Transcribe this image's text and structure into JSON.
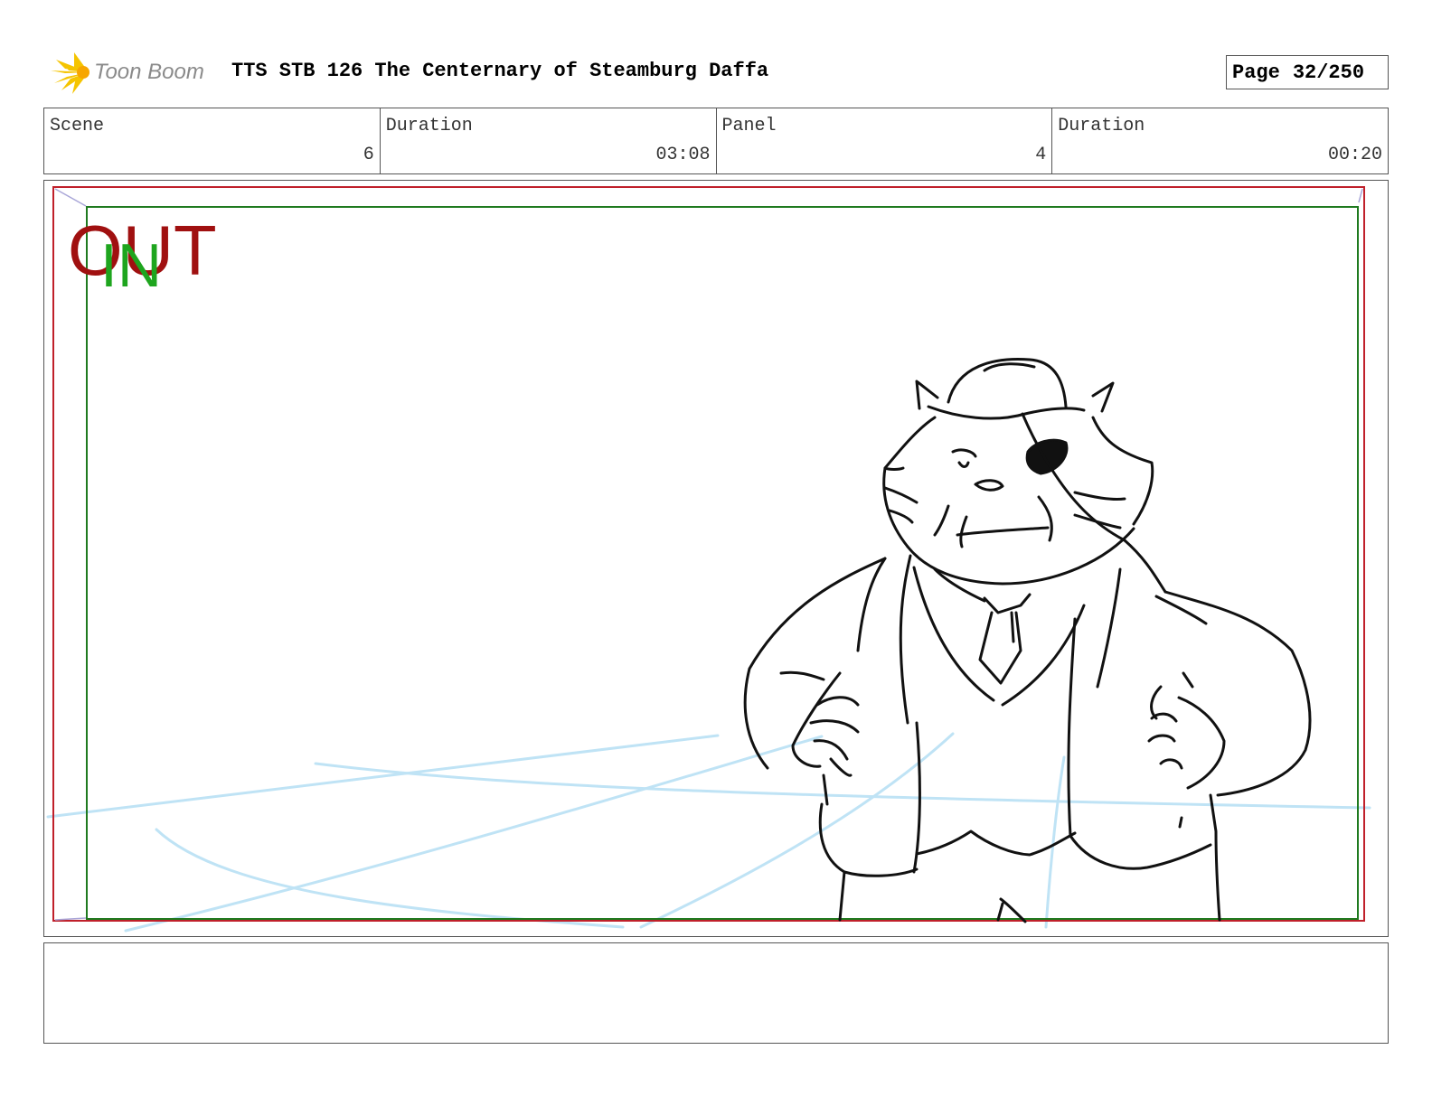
{
  "header": {
    "logo_text": "Toon Boom",
    "title": "TTS STB 126 The Centernary of Steamburg Daffa",
    "page_label": "Page",
    "page_value": "32/250"
  },
  "info": {
    "scene_label": "Scene",
    "scene_value": "6",
    "scene_duration_label": "Duration",
    "scene_duration_value": "03:08",
    "panel_label": "Panel",
    "panel_value": "4",
    "panel_duration_label": "Duration",
    "panel_duration_value": "00:20"
  },
  "panel": {
    "out_label": "OUT",
    "in_label": "IN"
  },
  "notes": {
    "text": ""
  },
  "colors": {
    "out_frame": "#c0202a",
    "in_frame": "#1f7a1f",
    "guide_lines": "#bfe3f5",
    "logo_yellow": "#f5c400"
  }
}
